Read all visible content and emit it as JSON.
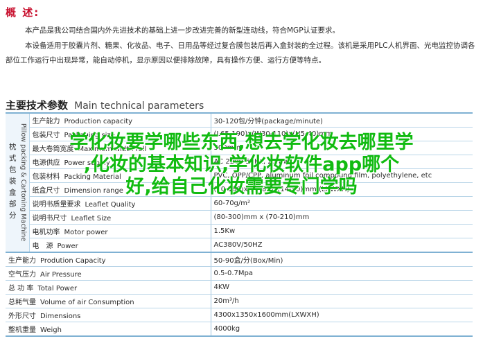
{
  "overview": {
    "title": "概 述:",
    "para1": "本产品是我公司结合国内外先进技术的基础上进一步改进完善的新型连动线，符合MGP认证要求。",
    "para2": "本设备适用于胶囊片剂、糖果、化妆品、电子、日用品等经过复合膜包装后再入盒封装的全过程。该机是采用PLC人机界面、光电监控协调各部位工作运行中出现异常，能自动停机，显示原因以便排除故障，具有操作方便、运行方便等特点。"
  },
  "tech": {
    "heading_zh": "主要技术参数",
    "heading_en": "Main technical parameters",
    "group_label_zh": "枕式包装盒部分",
    "group_label_en": "Pillow packing & Cartoning Machine",
    "group_rows": [
      {
        "zh": "生产能力",
        "en": "Production capacity",
        "value": "30-120包/分钟(package/minute)"
      },
      {
        "zh": "包装尺寸",
        "en": "Packaging size",
        "value": "(L65-190)x(W30-110)x(H5-40)mm"
      },
      {
        "zh": "最大卷筒宽度",
        "en": "Maximum width roll",
        "value": "300mm"
      },
      {
        "zh": "电源供应",
        "en": "Power supply",
        "value": "AC 220V 50Hz, 2.4Kw"
      },
      {
        "zh": "包装材料",
        "en": "Packing Material",
        "value": "PVC, OPP/CPP, aluminum foil compound film, polyethylene, etc"
      },
      {
        "zh": "纸盒尺寸",
        "en": "Dimension range",
        "value": "(70-180)x(35-85)x(14-50)mm (LXWXH)"
      },
      {
        "zh": "说明书质量要求",
        "en": "Leaflet Quality",
        "value": "60-70g/m²"
      },
      {
        "zh": "说明书尺寸",
        "en": "Leaflet Size",
        "value": "(80-300)mm x (70-210)mm"
      },
      {
        "zh": "电机功率",
        "en": "Motor power",
        "value": "1.5Kw"
      },
      {
        "zh": "电　源",
        "en": "Power",
        "value": "AC380V/50HZ"
      }
    ],
    "general_rows": [
      {
        "zh": "生产能力",
        "en": "Prodution Capacity",
        "value": "50-90盒/分(Box/Min)"
      },
      {
        "zh": "空气压力",
        "en": "Air Pressure",
        "value": "0.5-0.7Mpa"
      },
      {
        "zh": "总 功 率",
        "en": "Total Power",
        "value": "4KW"
      },
      {
        "zh": "总耗气量",
        "en": "Volume of air Consumption",
        "value": "20m³/h"
      },
      {
        "zh": "外形尺寸",
        "en": "Dimensions",
        "value": "4300x1350x1600mm(LXWXH)"
      },
      {
        "zh": "整机重量",
        "en": "Weigh",
        "value": "4000kg"
      }
    ]
  },
  "watermark": {
    "line1": "学化妆要学哪些东西,想去学化妆去哪里学",
    "line2": ",化妆的基本知识,学化妆软件app哪个",
    "line3": "好,给自己化妆需要专门学吗"
  },
  "colors": {
    "title_red": "#c8102e",
    "table_rule": "#7fb1d3",
    "watermark_green": "#11bb11"
  }
}
